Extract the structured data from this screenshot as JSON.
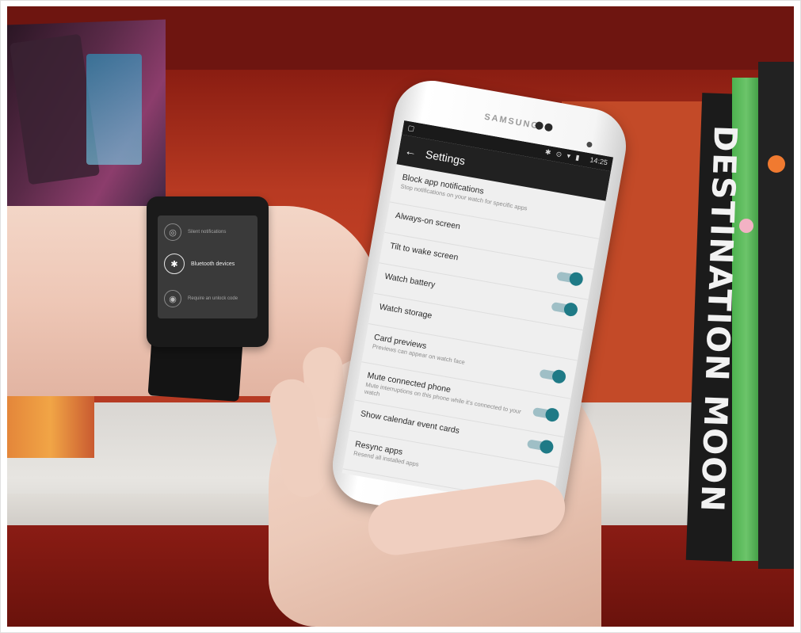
{
  "background_book": {
    "spine_title": "DESTINATION MOON"
  },
  "watch": {
    "items": [
      {
        "icon": "◎",
        "label": "Silent notifications"
      },
      {
        "icon": "✱",
        "label": "Bluetooth devices"
      },
      {
        "icon": "◉",
        "label": "Require an unlock code"
      }
    ]
  },
  "phone": {
    "brand": "SAMSUNG",
    "status": {
      "left_icon": "▢",
      "icons": "✱ ⊙ ▾ ▮",
      "time": "14:25"
    },
    "appbar": {
      "back_icon": "←",
      "title": "Settings"
    },
    "settings": [
      {
        "title": "Block app notifications",
        "subtitle": "Stop notifications on your watch for specific apps",
        "toggle": null
      },
      {
        "title": "Always-on screen",
        "subtitle": "",
        "toggle": null
      },
      {
        "title": "Tilt to wake screen",
        "subtitle": "",
        "toggle": true
      },
      {
        "title": "Watch battery",
        "subtitle": "",
        "toggle": true
      },
      {
        "title": "Watch storage",
        "subtitle": "",
        "toggle": null
      },
      {
        "title": "Card previews",
        "subtitle": "Previews can appear on watch face",
        "toggle": true
      },
      {
        "title": "Mute connected phone",
        "subtitle": "Mute interruptions on this phone while it's connected to your watch",
        "toggle": true
      },
      {
        "title": "Show calendar event cards",
        "subtitle": "",
        "toggle": true
      },
      {
        "title": "Resync apps",
        "subtitle": "Resend all installed apps",
        "toggle": null
      }
    ]
  },
  "colors": {
    "toggle_on": "#1f7a86",
    "appbar": "#212121",
    "wall": "#b83a22"
  }
}
